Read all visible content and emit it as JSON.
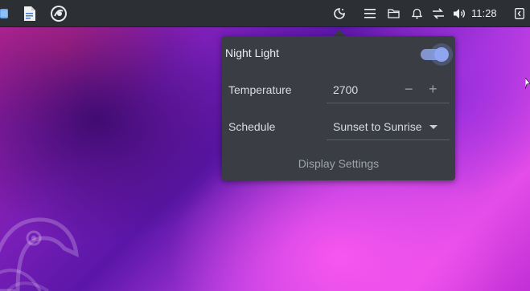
{
  "panel": {
    "left_icons": [
      "files-icon",
      "document-icon",
      "browser-icon"
    ],
    "tray_icons": [
      "night-light-icon",
      "menu-icon",
      "folder-icon",
      "notifications-icon",
      "network-icon",
      "volume-icon",
      "show-desktop-icon"
    ],
    "clock": "11:28"
  },
  "night_light": {
    "title": "Night Light",
    "enabled": true,
    "temperature_label": "Temperature",
    "temperature_value": "2700",
    "decrement_symbol": "−",
    "increment_symbol": "+",
    "schedule_label": "Schedule",
    "schedule_value": "Sunset to Sunrise",
    "display_settings_label": "Display Settings"
  },
  "colors": {
    "panel_bg": "#2c2f34",
    "popup_bg": "#3a3d44",
    "accent": "#8fa5ef"
  }
}
